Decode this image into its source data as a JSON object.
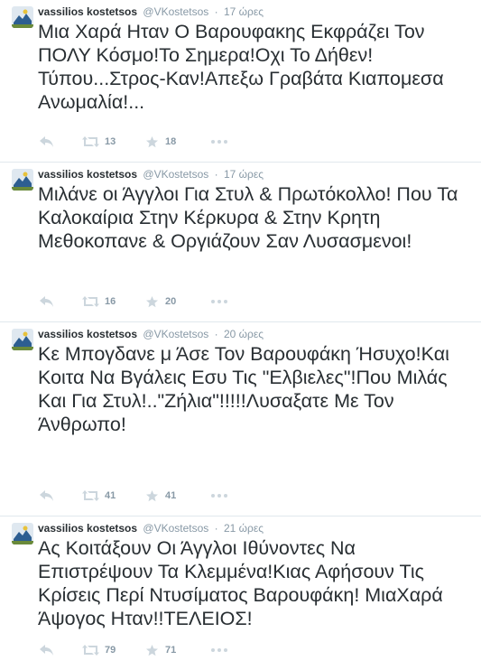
{
  "colors": {
    "text": "#292f33",
    "muted": "#8899a6",
    "icon": "#ccd6dd",
    "divider": "#e1e8ed"
  },
  "tweets": [
    {
      "fullname": "vassilios kostetsos",
      "username": "@VKostetsos",
      "separator": "·",
      "time": "17 ώρες",
      "text": "Μια Χαρά Ηταν Ο Βαρουφακης Εκφράζει Τον ΠΟΛΥ Κόσμο!Το Σημερα!Οχι Το Δήθεν! Τύπου...Στρος-Καν!Απεξω Γραβάτα Κιαπομεσα Ανωμαλία!...",
      "retweets": "13",
      "favorites": "18"
    },
    {
      "fullname": "vassilios kostetsos",
      "username": "@VKostetsos",
      "separator": "·",
      "time": "17 ώρες",
      "text": "Μιλάνε οι Άγγλοι Για Στυλ & Πρωτόκολλο! Που Τα Καλοκαίρια Στην Κέρκυρα & Στην Κρητη Μεθοκοπανε & Οργιάζουν Σαν Λυσασμενοι!",
      "retweets": "16",
      "favorites": "20"
    },
    {
      "fullname": "vassilios kostetsos",
      "username": "@VKostetsos",
      "separator": "·",
      "time": "20 ώρες",
      "text": "Κε Μπογδανε μ Άσε Τον Βαρουφάκη Ήσυχο!Και Κοιτα Να Βγάλεις Εσυ Τις \"Ελβιελες\"!Που Μιλάς Και Για Στυλ!..\"Ζήλια\"!!!!!Λυσαξατε Με Τον Άνθρωπο!",
      "retweets": "41",
      "favorites": "41"
    },
    {
      "fullname": "vassilios kostetsos",
      "username": "@VKostetsos",
      "separator": "·",
      "time": "21 ώρες",
      "text": "Ας Κοιτάξουν Οι Άγγλοι Ιθύνοντες Να Επιστρέψουν Τα Κλεμμένα!Κιας Αφήσουν Τις Κρίσεις Περί Ντυσίματος Βαρουφάκη! ΜιαΧαρά Άψογος Ηταν!!ΤΕΛΕΙΟΣ!",
      "retweets": "79",
      "favorites": "71"
    }
  ]
}
